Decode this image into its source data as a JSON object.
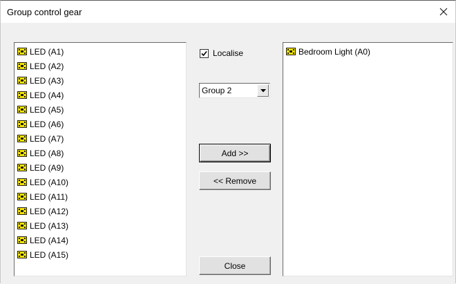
{
  "window": {
    "title": "Group control gear",
    "close_glyph": "✕"
  },
  "left_list": {
    "items": [
      {
        "label": "LED (A1)"
      },
      {
        "label": "LED (A2)"
      },
      {
        "label": "LED (A3)"
      },
      {
        "label": "LED (A4)"
      },
      {
        "label": "LED (A5)"
      },
      {
        "label": "LED (A6)"
      },
      {
        "label": "LED (A7)"
      },
      {
        "label": "LED (A8)"
      },
      {
        "label": "LED (A9)"
      },
      {
        "label": "LED (A10)"
      },
      {
        "label": "LED (A11)"
      },
      {
        "label": "LED (A12)"
      },
      {
        "label": "LED (A13)"
      },
      {
        "label": "LED (A14)"
      },
      {
        "label": "LED (A15)"
      }
    ]
  },
  "right_list": {
    "items": [
      {
        "label": "Bedroom Light (A0)"
      }
    ]
  },
  "controls": {
    "localise_label": "Localise",
    "localise_checked": true,
    "group_selected": "Group 2",
    "add_label": "Add >>",
    "remove_label": "<< Remove",
    "close_label": "Close"
  },
  "colors": {
    "icon_fill": "#f5e400",
    "icon_outline": "#1a1a1a"
  },
  "icons": {
    "list_item_icon": "control-gear-icon",
    "window_close_icon": "close-icon",
    "dropdown_icon": "chevron-down-icon",
    "check_icon": "checkmark-icon"
  }
}
